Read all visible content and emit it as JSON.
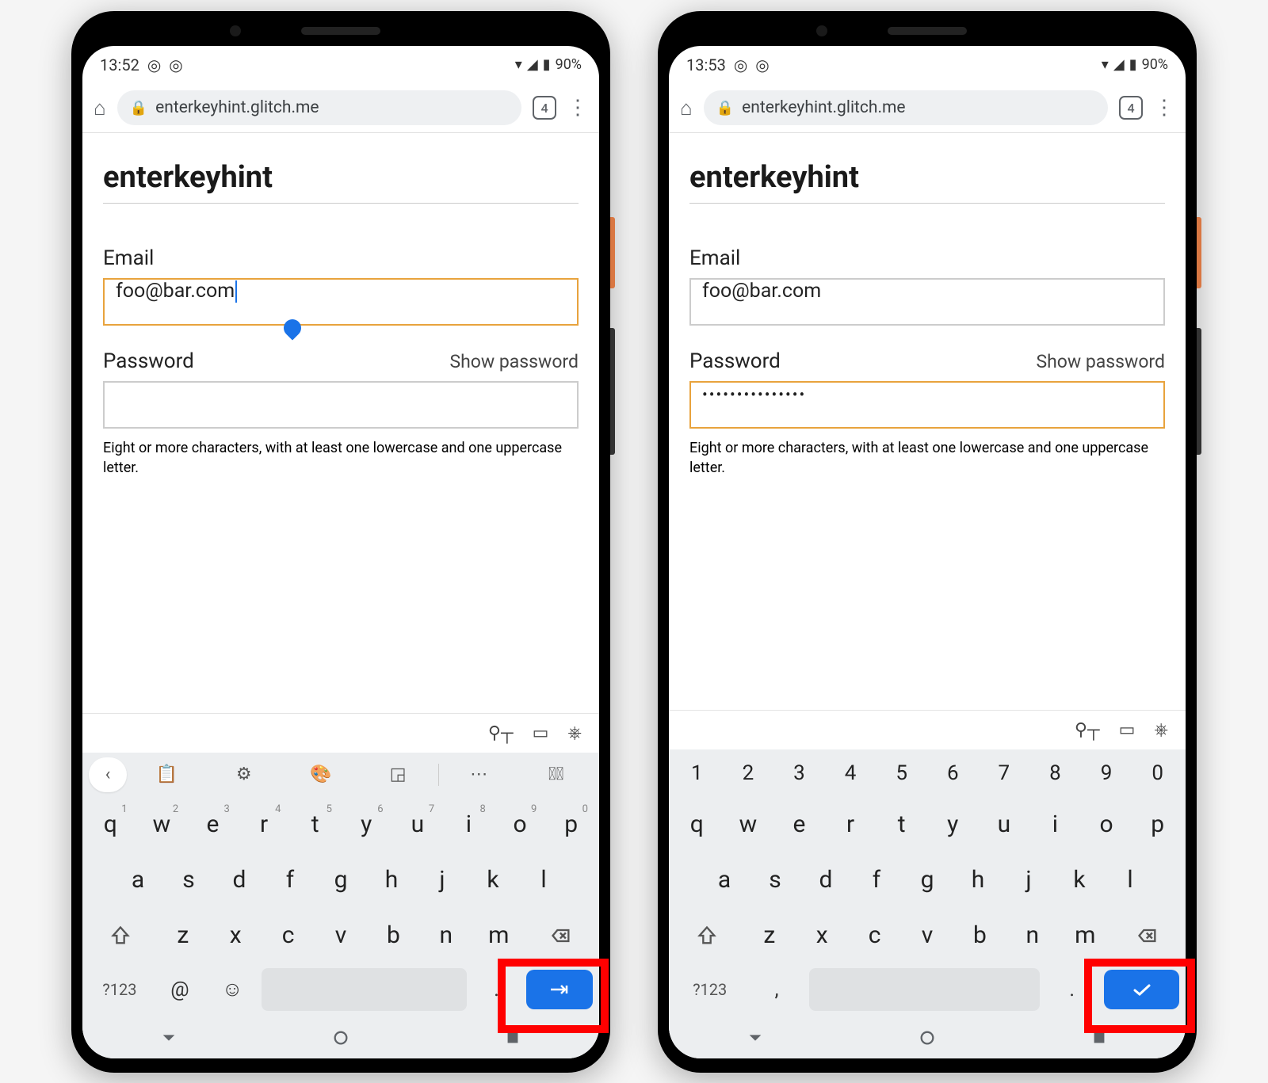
{
  "phones": [
    {
      "status": {
        "time": "13:52",
        "battery": "90%"
      },
      "browser": {
        "url": "enterkeyhint.glitch.me",
        "tab_count": "4"
      },
      "page": {
        "title": "enterkeyhint",
        "email_label": "Email",
        "email_value": "foo@bar.com",
        "email_focused": true,
        "password_label": "Password",
        "show_password": "Show password",
        "password_value": "",
        "password_focused": false,
        "hint": "Eight or more characters, with at least one lowercase and one uppercase letter."
      },
      "keyboard": {
        "show_toolbar": true,
        "show_number_row": false,
        "row1": [
          "q",
          "w",
          "e",
          "r",
          "t",
          "y",
          "u",
          "i",
          "o",
          "p"
        ],
        "row1_sup": [
          "1",
          "2",
          "3",
          "4",
          "5",
          "6",
          "7",
          "8",
          "9",
          "0"
        ],
        "row2": [
          "a",
          "s",
          "d",
          "f",
          "g",
          "h",
          "j",
          "k",
          "l"
        ],
        "row3": [
          "z",
          "x",
          "c",
          "v",
          "b",
          "n",
          "m"
        ],
        "sym_label": "?123",
        "extra_left": "@",
        "extra_right": ".",
        "enter_type": "next"
      }
    },
    {
      "status": {
        "time": "13:53",
        "battery": "90%"
      },
      "browser": {
        "url": "enterkeyhint.glitch.me",
        "tab_count": "4"
      },
      "page": {
        "title": "enterkeyhint",
        "email_label": "Email",
        "email_value": "foo@bar.com",
        "email_focused": false,
        "password_label": "Password",
        "show_password": "Show password",
        "password_value": "•••••••••••••••",
        "password_focused": true,
        "hint": "Eight or more characters, with at least one lowercase and one uppercase letter."
      },
      "keyboard": {
        "show_toolbar": false,
        "show_number_row": true,
        "number_row": [
          "1",
          "2",
          "3",
          "4",
          "5",
          "6",
          "7",
          "8",
          "9",
          "0"
        ],
        "row1": [
          "q",
          "w",
          "e",
          "r",
          "t",
          "y",
          "u",
          "i",
          "o",
          "p"
        ],
        "row1_sup": [],
        "row2": [
          "a",
          "s",
          "d",
          "f",
          "g",
          "h",
          "j",
          "k",
          "l"
        ],
        "row3": [
          "z",
          "x",
          "c",
          "v",
          "b",
          "n",
          "m"
        ],
        "sym_label": "?123",
        "extra_left": ",",
        "extra_right": ".",
        "enter_type": "done"
      }
    }
  ]
}
